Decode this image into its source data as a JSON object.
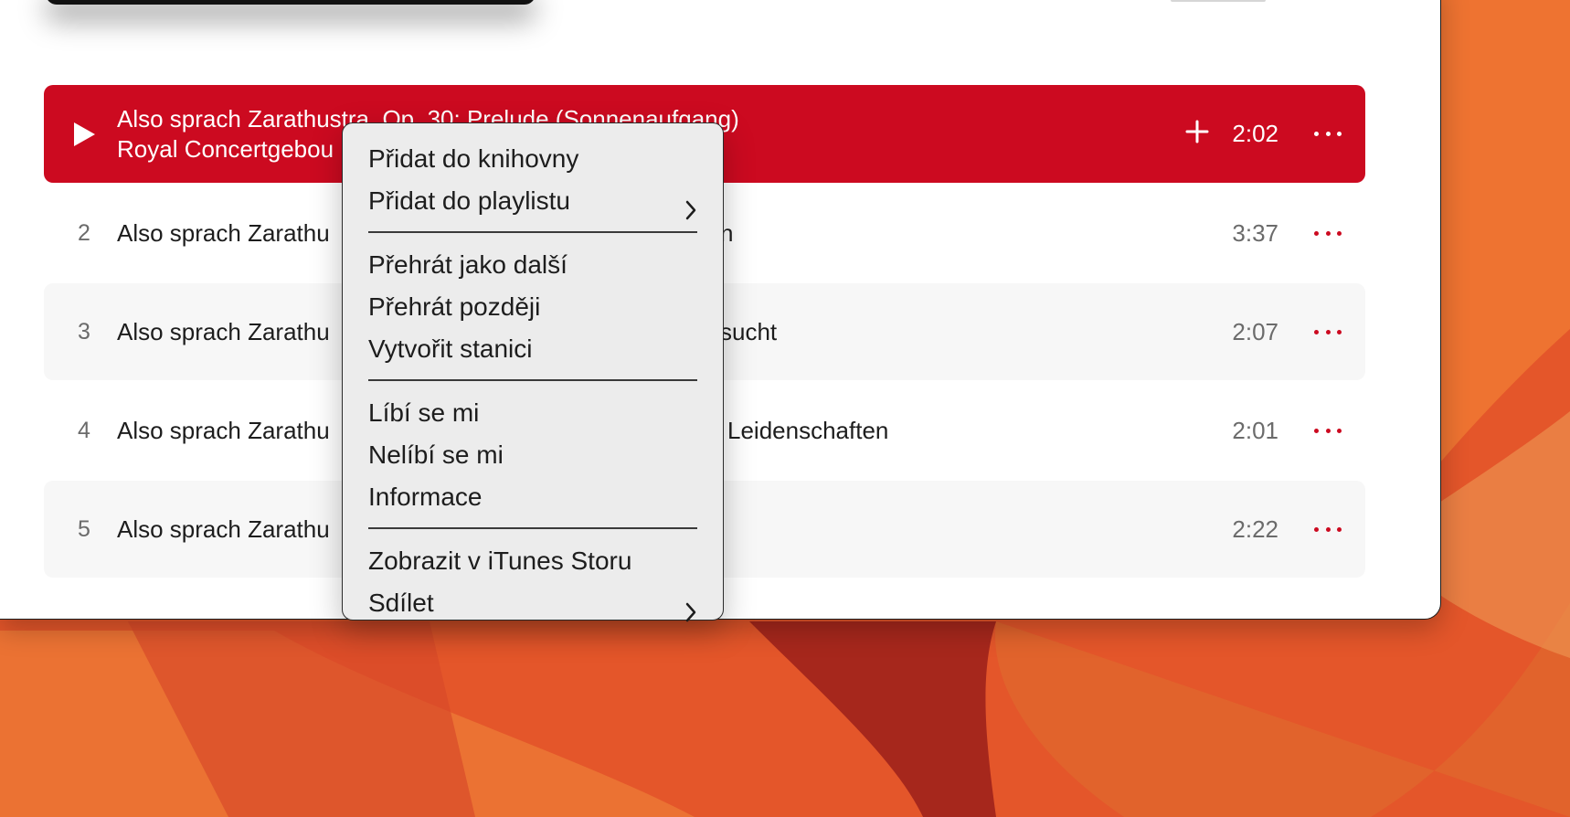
{
  "colors": {
    "accent": "#cc0a20",
    "wallpaper": "#e4562a"
  },
  "tracks": [
    {
      "number": "",
      "title": "Also sprach Zarathustra, Op. 30: Prelude (Sonnenaufgang)",
      "artist": "Royal Concertgebou",
      "duration": "2:02",
      "suffix": "",
      "selected": true
    },
    {
      "number": "2",
      "title": "Also sprach Zarathu",
      "suffix": "n",
      "duration": "3:37"
    },
    {
      "number": "3",
      "title": "Also sprach Zarathu",
      "suffix": "sucht",
      "duration": "2:07"
    },
    {
      "number": "4",
      "title": "Also sprach Zarathu",
      "suffix": "Leidenschaften",
      "duration": "2:01"
    },
    {
      "number": "5",
      "title": "Also sprach Zarathu",
      "suffix": "",
      "duration": "2:22"
    }
  ],
  "icons": {
    "play": "play-icon",
    "add": "plus-icon",
    "more": "ellipsis-icon",
    "submenu": "chevron-right-icon"
  },
  "context_menu": {
    "groups": [
      [
        "Přidat do knihovny",
        "Přidat do playlistu"
      ],
      [
        "Přehrát jako další",
        "Přehrát později",
        "Vytvořit stanici"
      ],
      [
        "Líbí se mi",
        "Nelíbí se mi",
        "Informace"
      ],
      [
        "Zobrazit v iTunes Storu",
        "Sdílet"
      ]
    ]
  }
}
